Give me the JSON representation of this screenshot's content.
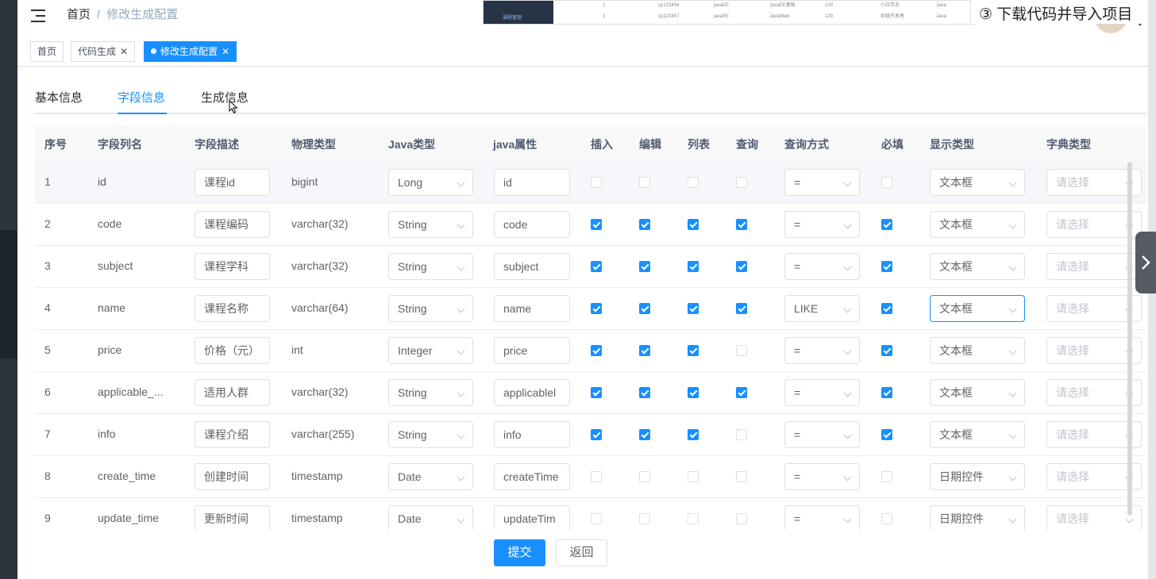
{
  "navbar": {
    "breadcrumb": [
      "首页",
      "修改生成配置"
    ],
    "breadcrumb_sep": "/"
  },
  "overlay": {
    "step_text": "③ 下载代码并导入项目",
    "thumb_sidebar_text": "课程管理",
    "thumb_rows": [
      [
        "1",
        "cp123456",
        "javaEE",
        "JavaEE基础",
        "100",
        "小白学员",
        "Java"
      ],
      [
        "2",
        "cp123457",
        "javaEE",
        "JavaWeb",
        "100",
        "初级开发者",
        "Java"
      ]
    ]
  },
  "tags": [
    {
      "label": "首页",
      "active": false,
      "closable": false
    },
    {
      "label": "代码生成",
      "active": false,
      "closable": true
    },
    {
      "label": "修改生成配置",
      "active": true,
      "closable": true
    }
  ],
  "tabs": [
    "基本信息",
    "字段信息",
    "生成信息"
  ],
  "active_tab": 1,
  "table": {
    "headers": [
      "序号",
      "字段列名",
      "字段描述",
      "物理类型",
      "Java类型",
      "java属性",
      "插入",
      "编辑",
      "列表",
      "查询",
      "查询方式",
      "必填",
      "显示类型",
      "字典类型"
    ],
    "dict_placeholder": "请选择",
    "rows": [
      {
        "no": "1",
        "column": "id",
        "desc": "课程id",
        "phys": "bigint",
        "java_type": "Long",
        "prop": "id",
        "insert": false,
        "edit": false,
        "list": false,
        "query": false,
        "query_type": "=",
        "required": false,
        "html_type": "文本框"
      },
      {
        "no": "2",
        "column": "code",
        "desc": "课程编码",
        "phys": "varchar(32)",
        "java_type": "String",
        "prop": "code",
        "insert": true,
        "edit": true,
        "list": true,
        "query": true,
        "query_type": "=",
        "required": true,
        "html_type": "文本框"
      },
      {
        "no": "3",
        "column": "subject",
        "desc": "课程学科",
        "phys": "varchar(32)",
        "java_type": "String",
        "prop": "subject",
        "insert": true,
        "edit": true,
        "list": true,
        "query": true,
        "query_type": "=",
        "required": true,
        "html_type": "文本框"
      },
      {
        "no": "4",
        "column": "name",
        "desc": "课程名称",
        "phys": "varchar(64)",
        "java_type": "String",
        "prop": "name",
        "insert": true,
        "edit": true,
        "list": true,
        "query": true,
        "query_type": "LIKE",
        "required": true,
        "html_type": "文本框"
      },
      {
        "no": "5",
        "column": "price",
        "desc": "价格（元）",
        "phys": "int",
        "java_type": "Integer",
        "prop": "price",
        "insert": true,
        "edit": true,
        "list": true,
        "query": false,
        "query_type": "=",
        "required": true,
        "html_type": "文本框"
      },
      {
        "no": "6",
        "column": "applicable_...",
        "desc": "适用人群",
        "phys": "varchar(32)",
        "java_type": "String",
        "prop": "applicablel",
        "insert": true,
        "edit": true,
        "list": true,
        "query": true,
        "query_type": "=",
        "required": true,
        "html_type": "文本框"
      },
      {
        "no": "7",
        "column": "info",
        "desc": "课程介绍",
        "phys": "varchar(255)",
        "java_type": "String",
        "prop": "info",
        "insert": true,
        "edit": true,
        "list": true,
        "query": false,
        "query_type": "=",
        "required": true,
        "html_type": "文本框"
      },
      {
        "no": "8",
        "column": "create_time",
        "desc": "创建时间",
        "phys": "timestamp",
        "java_type": "Date",
        "prop": "createTime",
        "insert": false,
        "edit": false,
        "list": false,
        "query": false,
        "query_type": "=",
        "required": false,
        "html_type": "日期控件"
      },
      {
        "no": "9",
        "column": "update_time",
        "desc": "更新时间",
        "phys": "timestamp",
        "java_type": "Date",
        "prop": "updateTim",
        "insert": false,
        "edit": false,
        "list": false,
        "query": false,
        "query_type": "=",
        "required": false,
        "html_type": "日期控件"
      }
    ]
  },
  "buttons": {
    "submit": "提交",
    "back": "返回"
  },
  "colors": {
    "primary": "#1890ff",
    "sidebar": "#2c333d"
  }
}
